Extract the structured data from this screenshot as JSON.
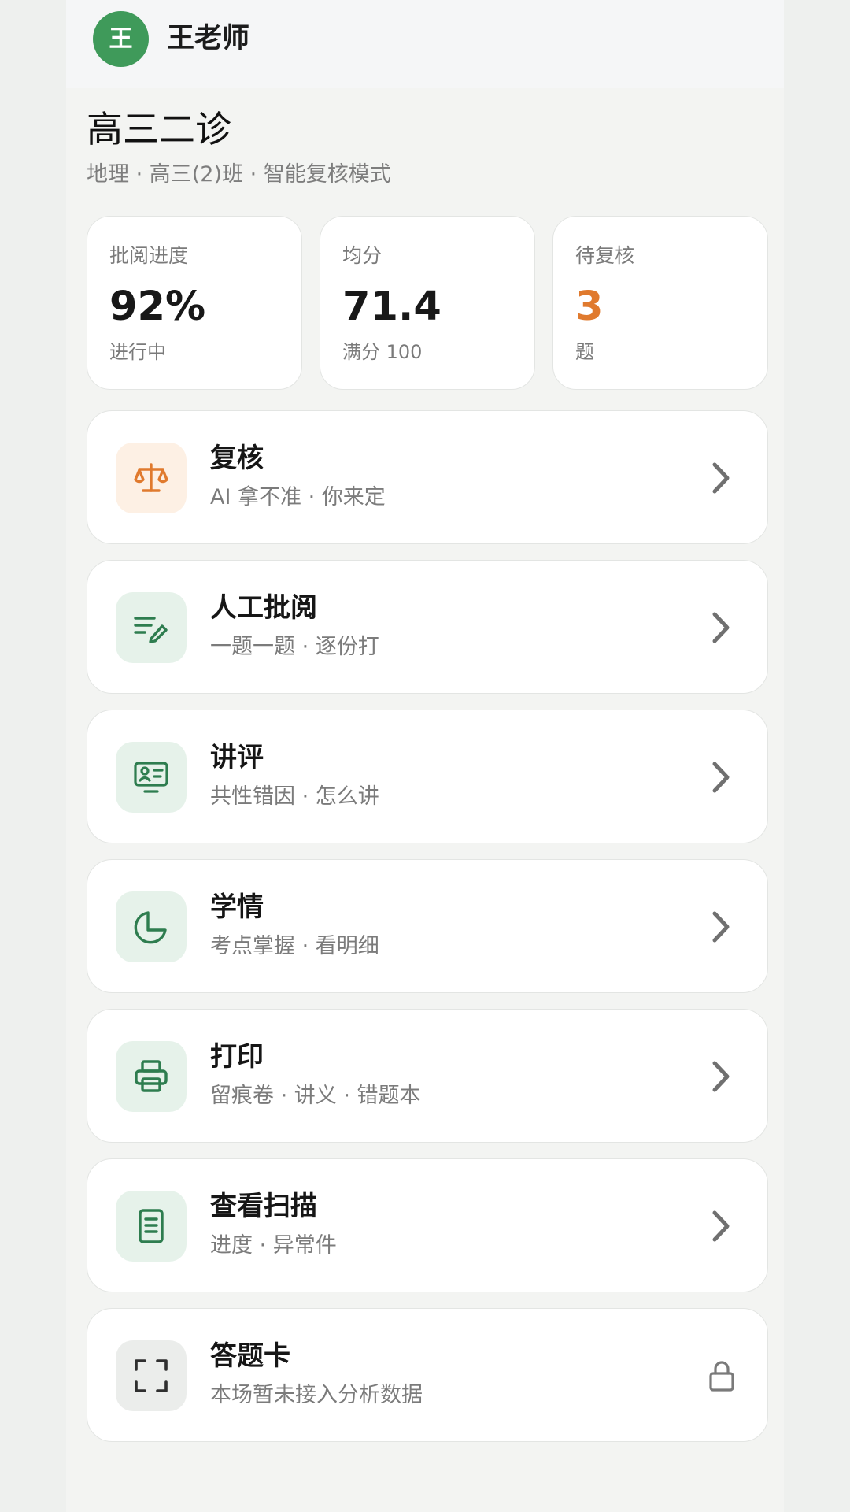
{
  "header": {
    "avatar_text": "王",
    "teacher_name": "王老师"
  },
  "exam": {
    "title": "高三二诊",
    "subtitle": "地理 · 高三(2)班 · 智能复核模式"
  },
  "stats": [
    {
      "label": "批阅进度",
      "value": "92%",
      "note": "进行中"
    },
    {
      "label": "均分",
      "value": "71.4",
      "note": "满分 100"
    },
    {
      "label": "待复核",
      "value": "3",
      "note": "题"
    }
  ],
  "menu": [
    {
      "title": "复核",
      "subtitle": "AI 拿不准 · 你来定",
      "icon": "balance-scale-icon"
    },
    {
      "title": "人工批阅",
      "subtitle": "一题一题 · 逐份打",
      "icon": "pen-lines-icon"
    },
    {
      "title": "讲评",
      "subtitle": "共性错因 · 怎么讲",
      "icon": "presentation-card-icon"
    },
    {
      "title": "学情",
      "subtitle": "考点掌握 · 看明细",
      "icon": "pie-chart-icon"
    },
    {
      "title": "打印",
      "subtitle": "留痕卷 · 讲义 · 错题本",
      "icon": "printer-icon"
    },
    {
      "title": "查看扫描",
      "subtitle": "进度 · 异常件",
      "icon": "document-icon"
    },
    {
      "title": "答题卡",
      "subtitle": "本场暂未接入分析数据",
      "icon": "scan-frame-icon",
      "locked": true
    }
  ],
  "colors": {
    "accent_green": "#2e7d4f",
    "avatar_green": "#3f9a5a",
    "warning_orange": "#e07a2e"
  }
}
